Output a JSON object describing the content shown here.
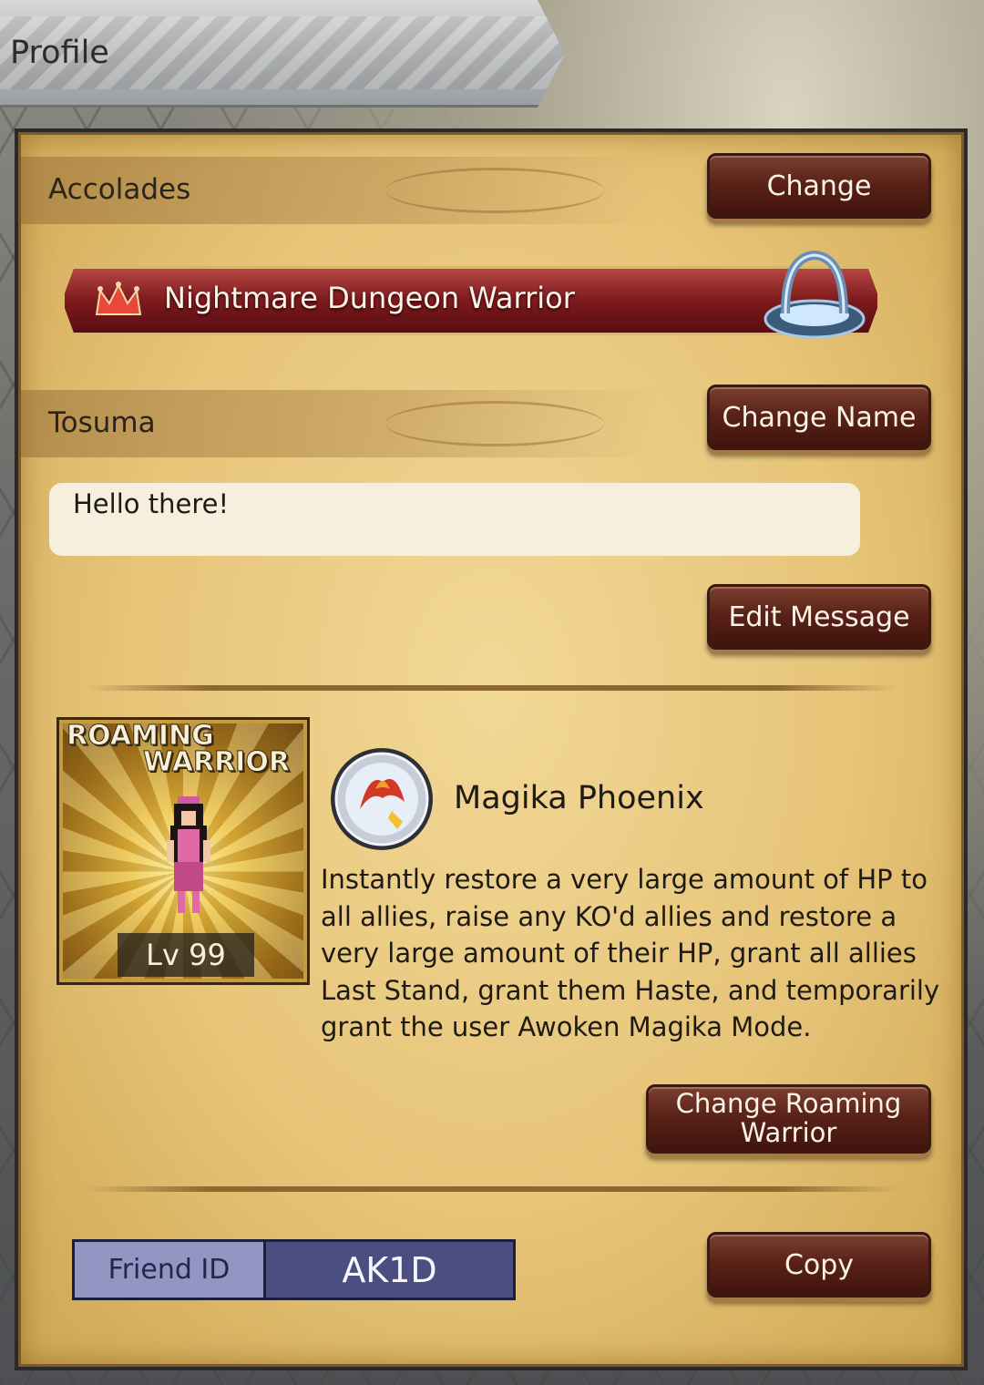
{
  "header": {
    "title": "Profile"
  },
  "accolades": {
    "label": "Accolades",
    "change_button": "Change",
    "title": "Nightmare Dungeon Warrior"
  },
  "player": {
    "name": "Tosuma",
    "change_name_button": "Change Name",
    "message": "Hello there!",
    "edit_message_button": "Edit Message"
  },
  "roaming_warrior": {
    "card_title_line1": "ROAMING",
    "card_title_line2": "WARRIOR",
    "level": "Lv 99",
    "ability_name": "Magika Phoenix",
    "ability_description": "Instantly restore a very large amount of HP to all allies, raise any KO'd allies and restore a very large amount of their HP, grant all allies Last Stand, grant them Haste, and temporarily grant the user Awoken Magika Mode.",
    "change_button": "Change Roaming Warrior"
  },
  "friend": {
    "label": "Friend ID",
    "id": "AK1D",
    "copy_button": "Copy"
  },
  "icons": {
    "crown": "crown-icon",
    "portal": "portal-icon",
    "ability": "phoenix-ability-icon",
    "sprite": "warrior-sprite"
  },
  "colors": {
    "button": "#5a2218",
    "panel": "#e6c478",
    "accolade_banner": "#7d1a1c",
    "friend_id_bg": "#4a4e80",
    "friend_label_bg": "#9296c2"
  }
}
